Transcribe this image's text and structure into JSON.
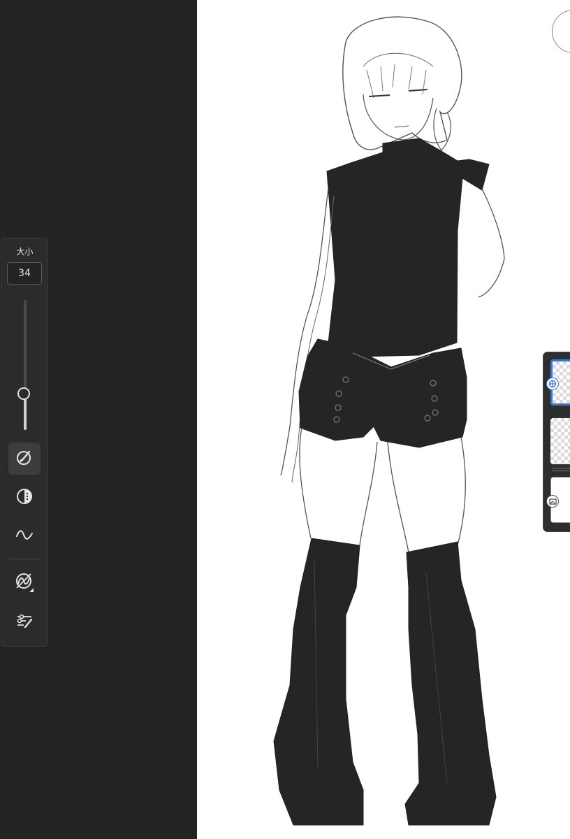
{
  "brush_panel": {
    "size_label": "大小",
    "size_value": "34",
    "size_level": 0.28,
    "tools": [
      {
        "name": "brush-settings-icon",
        "active": true
      },
      {
        "name": "opacity-icon",
        "active": false
      },
      {
        "name": "stabilizer-icon",
        "active": false
      },
      {
        "name": "blend-mode-icon",
        "active": false
      },
      {
        "name": "brush-adjust-icon",
        "active": false
      }
    ]
  },
  "layers": [
    {
      "name": "layer-sketch",
      "selected": true
    },
    {
      "name": "layer-2",
      "selected": false
    },
    {
      "name": "layer-background",
      "selected": false
    }
  ],
  "colors": {
    "panel_bg": "#232323",
    "toolbar_bg": "#2b2b2b",
    "canvas_bg": "#ffffff",
    "ink": "#252525",
    "selection": "#3b78d8"
  }
}
